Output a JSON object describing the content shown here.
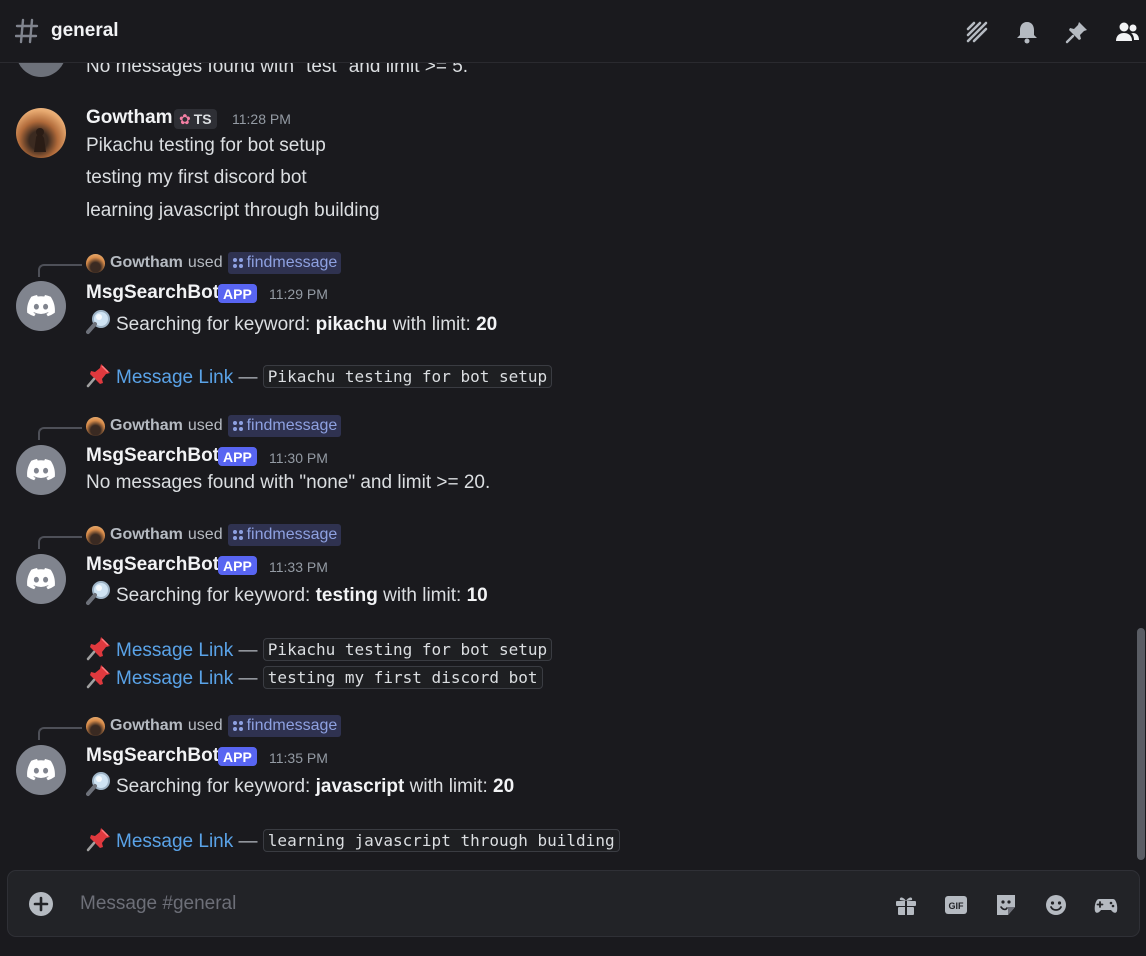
{
  "header": {
    "channel": "general"
  },
  "prev_message": {
    "text": "No messages found with \"test\" and limit >= 5."
  },
  "user_message": {
    "author": "Gowtham",
    "tag": "TS",
    "time": "11:28 PM",
    "lines": [
      "Pikachu testing for bot setup",
      "testing my first discord bot",
      "learning javascript through building"
    ]
  },
  "bot_messages": [
    {
      "reply_user": "Gowtham",
      "reply_used": "used",
      "command": "findmessage",
      "author": "MsgSearchBot",
      "badge": "APP",
      "time": "11:29 PM",
      "search_prefix": "Searching for keyword:",
      "keyword": "pikachu",
      "limit_label": "with limit:",
      "limit": "20",
      "results": [
        {
          "link": "Message Link",
          "dash": "—",
          "code": "Pikachu testing for bot setup"
        }
      ]
    },
    {
      "reply_user": "Gowtham",
      "reply_used": "used",
      "command": "findmessage",
      "author": "MsgSearchBot",
      "badge": "APP",
      "time": "11:30 PM",
      "text": "No messages found with \"none\" and limit >= 20."
    },
    {
      "reply_user": "Gowtham",
      "reply_used": "used",
      "command": "findmessage",
      "author": "MsgSearchBot",
      "badge": "APP",
      "time": "11:33 PM",
      "search_prefix": "Searching for keyword:",
      "keyword": "testing",
      "limit_label": "with limit:",
      "limit": "10",
      "results": [
        {
          "link": "Message Link",
          "dash": "—",
          "code": "Pikachu testing for bot setup"
        },
        {
          "link": "Message Link",
          "dash": "—",
          "code": "testing my first discord bot"
        }
      ]
    },
    {
      "reply_user": "Gowtham",
      "reply_used": "used",
      "command": "findmessage",
      "author": "MsgSearchBot",
      "badge": "APP",
      "time": "11:35 PM",
      "search_prefix": "Searching for keyword:",
      "keyword": "javascript",
      "limit_label": "with limit:",
      "limit": "20",
      "results": [
        {
          "link": "Message Link",
          "dash": "—",
          "code": "learning javascript through building"
        }
      ]
    }
  ],
  "composer": {
    "placeholder": "Message #general"
  },
  "icons": {
    "header": [
      "threads-icon",
      "bell-icon",
      "pin-icon",
      "members-icon"
    ],
    "composer": [
      "plus-icon",
      "gift-icon",
      "gif-icon",
      "sticker-icon",
      "emoji-icon",
      "apps-icon"
    ]
  },
  "colors": {
    "background": "#1a1a1e",
    "app_badge": "#5865f2",
    "link": "#5aa3e8",
    "command_pill": "#2f3250"
  }
}
